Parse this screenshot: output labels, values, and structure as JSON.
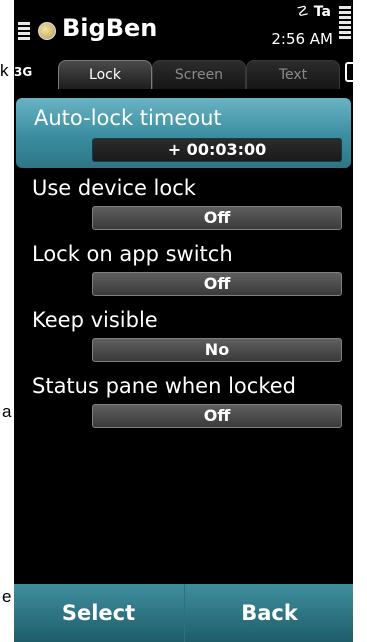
{
  "side_labels": {
    "top_left": "k",
    "mid_left": "a",
    "bottom_left": "e"
  },
  "status": {
    "app_title": "BigBen",
    "network": "☡ Ta",
    "time": "2:56 AM"
  },
  "tabs": {
    "left_edge": "3G",
    "items": [
      {
        "label": "Lock",
        "active": true
      },
      {
        "label": "Screen",
        "active": false
      },
      {
        "label": "Text",
        "active": false
      }
    ]
  },
  "settings": [
    {
      "label": "Auto-lock timeout",
      "value": "+ 00:03:00",
      "selected": true
    },
    {
      "label": "Use device lock",
      "value": "Off",
      "selected": false
    },
    {
      "label": "Lock on app switch",
      "value": "Off",
      "selected": false
    },
    {
      "label": "Keep visible",
      "value": "No",
      "selected": false
    },
    {
      "label": "Status pane when locked",
      "value": "Off",
      "selected": false
    }
  ],
  "softkeys": {
    "left": "Select",
    "right": "Back"
  },
  "colors": {
    "accent": "#3a8da0",
    "softkey_bg": "#2f7585",
    "background": "#000000"
  }
}
